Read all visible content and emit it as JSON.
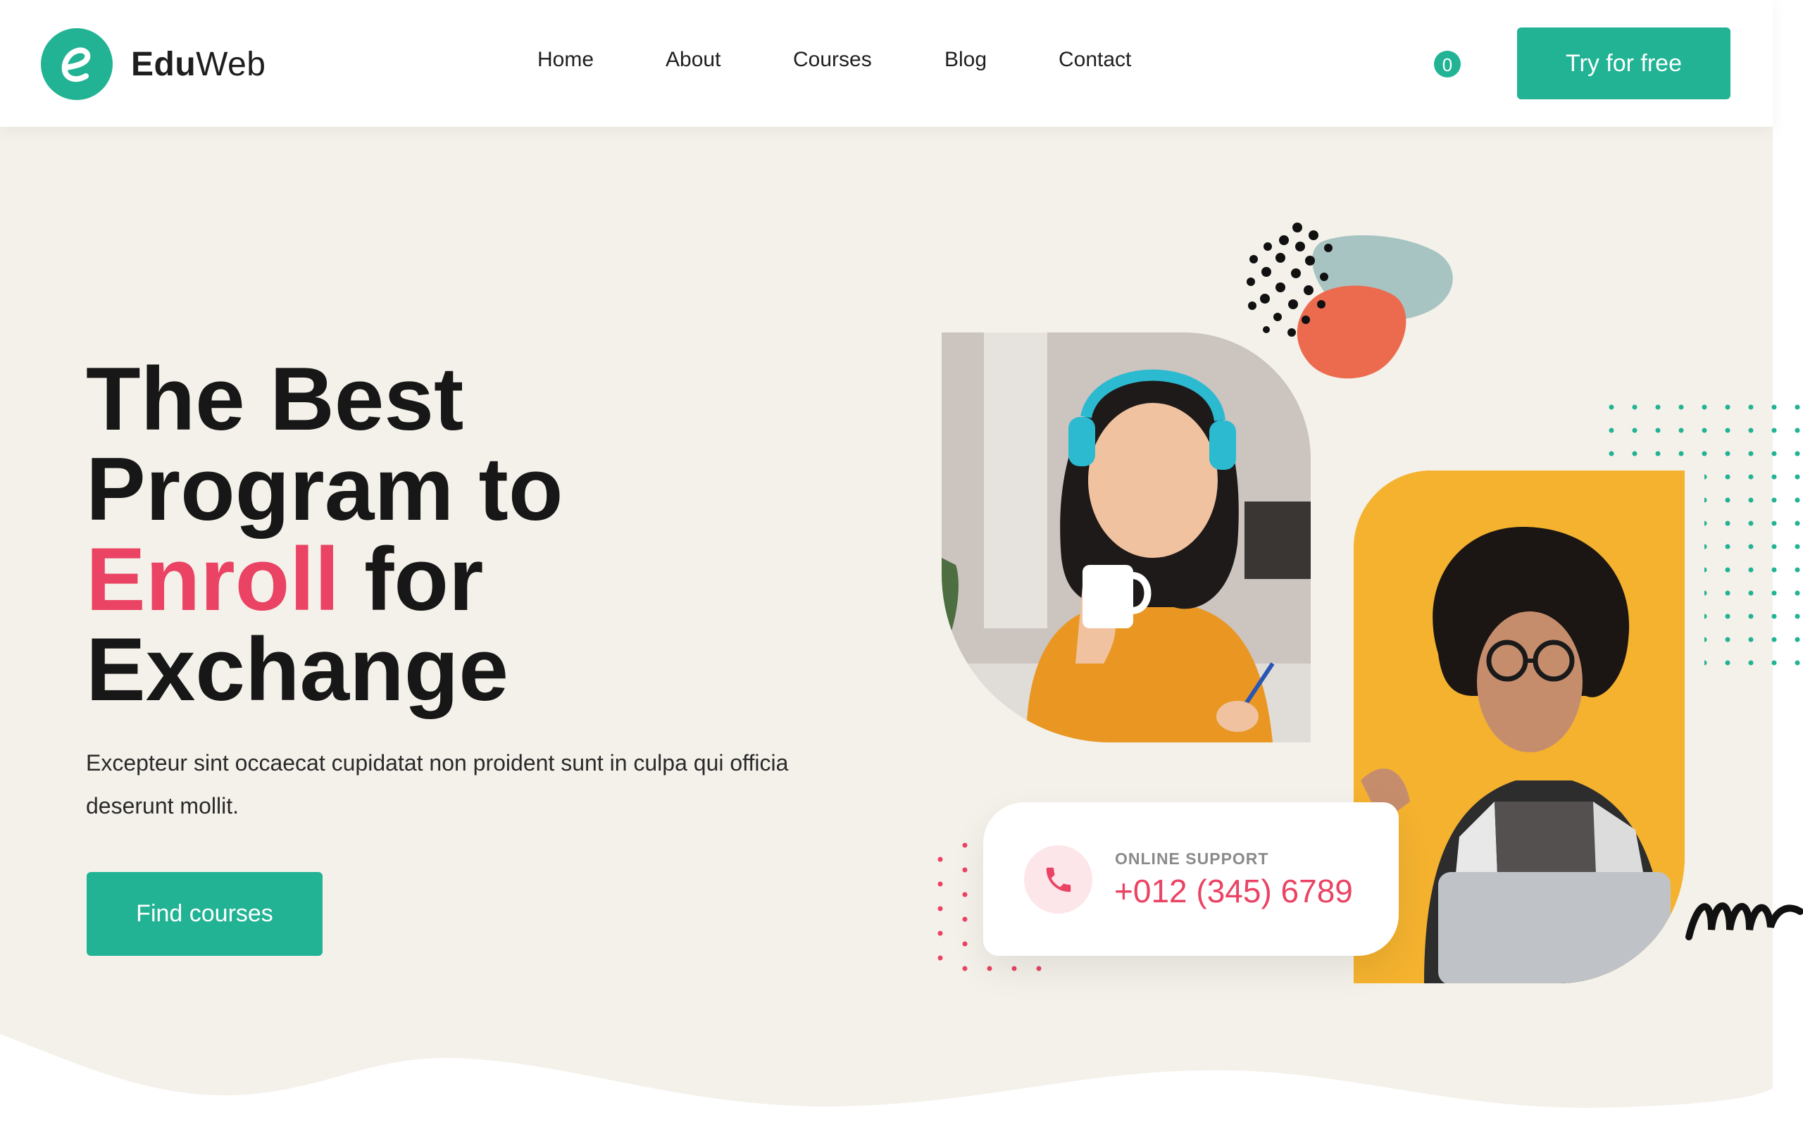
{
  "brand": {
    "name_bold": "Edu",
    "name_light": "Web",
    "logo_letter": "e"
  },
  "nav": {
    "items": [
      {
        "id": "home",
        "label": "Home"
      },
      {
        "id": "about",
        "label": "About"
      },
      {
        "id": "courses",
        "label": "Courses"
      },
      {
        "id": "blog",
        "label": "Blog"
      },
      {
        "id": "contact",
        "label": "Contact"
      }
    ]
  },
  "cart": {
    "count": "0"
  },
  "header": {
    "cta_label": "Try for free"
  },
  "hero": {
    "title_line1": "The Best",
    "title_line2": "Program to",
    "title_accent": "Enroll",
    "title_line3_rest": " for",
    "title_line4": "Exchange",
    "description": "Excepteur sint occaecat cupidatat non proident sunt in culpa qui officia deserunt mollit.",
    "cta_label": "Find courses"
  },
  "support": {
    "label": "ONLINE SUPPORT",
    "phone": "+012 (345) 6789"
  },
  "colors": {
    "accent_green": "#21b394",
    "accent_pink": "#ea4363",
    "hero_background": "#f4f1ea",
    "blob_orange": "#ec6b4e",
    "blob_grey": "#a7c4c3",
    "photo_yellow": "#f4b22f"
  },
  "icons": [
    "logo-e-icon",
    "phone-icon",
    "cart-count-badge"
  ]
}
